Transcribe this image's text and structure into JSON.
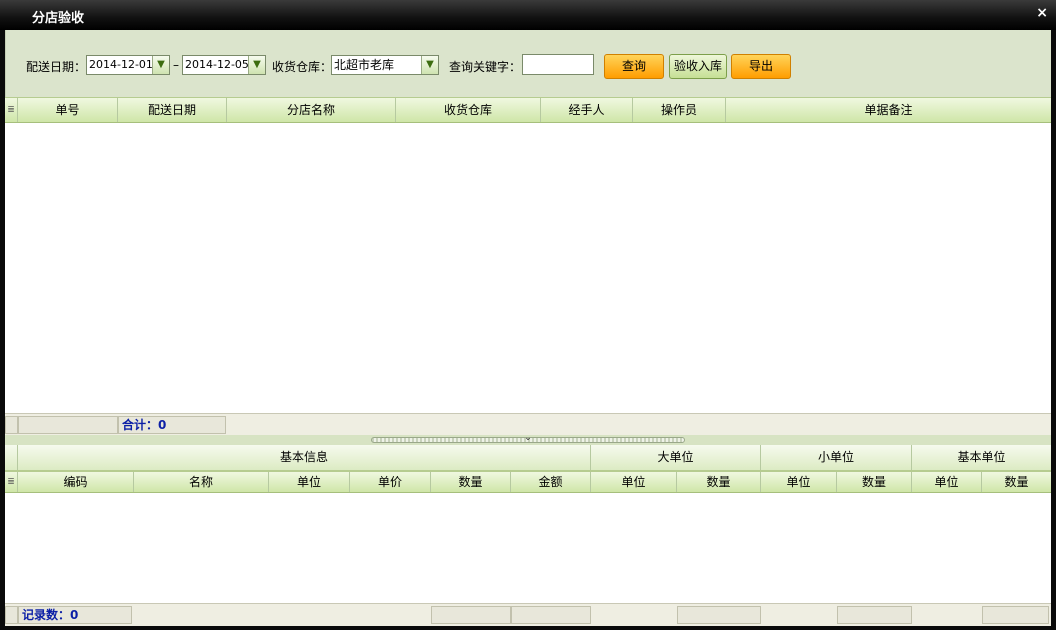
{
  "window": {
    "title": "分店验收",
    "close_glyph": "×"
  },
  "toolbar": {
    "date_label": "配送日期：",
    "date_from": "2014-12-01",
    "date_sep": "–",
    "date_to": "2014-12-05",
    "warehouse_label": "收货仓库：",
    "warehouse_value": "北超市老库",
    "keyword_label": "查询关键字：",
    "keyword_value": "",
    "query_button": "查询",
    "accept_button": "验收入库",
    "export_button": "导出",
    "dropdown_glyph": "▼"
  },
  "top_grid": {
    "selector_glyph": "≣",
    "columns": [
      "单号",
      "配送日期",
      "分店名称",
      "收货仓库",
      "经手人",
      "操作员",
      "单据备注"
    ],
    "rows": [],
    "footer_total": "合计：0"
  },
  "splitter": {
    "arrow_glyph": "⌄"
  },
  "bottom_grid": {
    "selector_glyph": "≣",
    "groups": [
      "基本信息",
      "大单位",
      "小单位",
      "基本单位"
    ],
    "columns": [
      "编码",
      "名称",
      "单位",
      "单价",
      "数量",
      "金额",
      "单位",
      "数量",
      "单位",
      "数量",
      "单位",
      "数量"
    ],
    "rows": [],
    "footer_count": "记录数：0"
  },
  "colors": {
    "accent_green": "#cfe6a8",
    "button_orange": "#ff9d00",
    "total_text": "#0b1fa6"
  }
}
